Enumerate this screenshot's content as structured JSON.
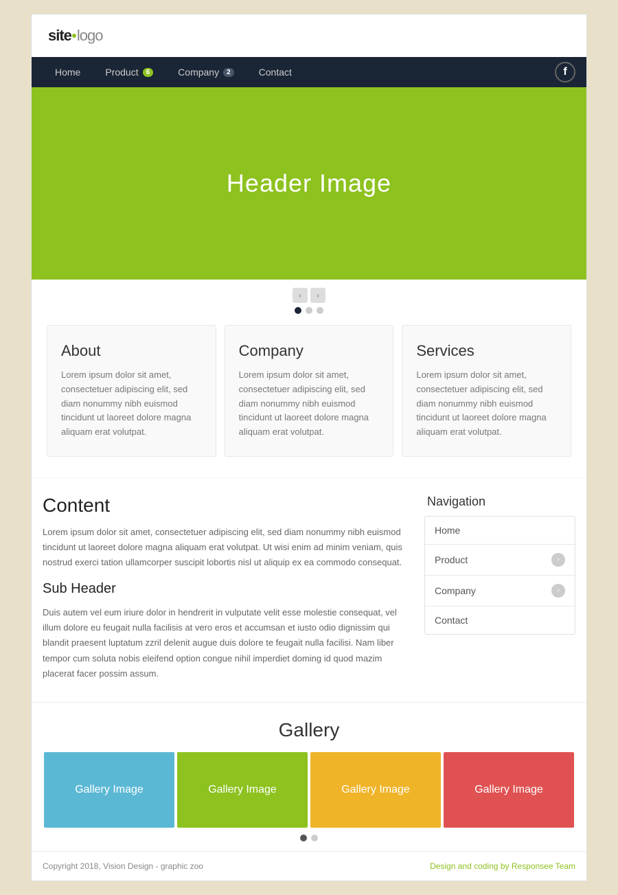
{
  "header": {
    "logo_site": "site",
    "logo_rest": "logo"
  },
  "nav": {
    "items": [
      {
        "label": "Home",
        "badge": null
      },
      {
        "label": "Product",
        "badge": "6",
        "badge_type": "green"
      },
      {
        "label": "Company",
        "badge": "2",
        "badge_type": "dark"
      },
      {
        "label": "Contact",
        "badge": null
      }
    ],
    "facebook_label": "f"
  },
  "hero": {
    "text": "Header Image"
  },
  "slider": {
    "prev_arrow": "‹",
    "next_arrow": "›",
    "dots": [
      true,
      false,
      false
    ]
  },
  "cards": [
    {
      "title": "About",
      "text": "Lorem ipsum dolor sit amet, consectetuer adipiscing elit, sed diam nonummy nibh euismod tincidunt ut laoreet dolore magna aliquam erat volutpat."
    },
    {
      "title": "Company",
      "text": "Lorem ipsum dolor sit amet, consectetuer adipiscing elit, sed diam nonummy nibh euismod tincidunt ut laoreet dolore magna aliquam erat volutpat."
    },
    {
      "title": "Services",
      "text": "Lorem ipsum dolor sit amet, consectetuer adipiscing elit, sed diam nonummy nibh euismod tincidunt ut laoreet dolore magna aliquam erat volutpat."
    }
  ],
  "content": {
    "title": "Content",
    "main_text": "Lorem ipsum dolor sit amet, consectetuer adipiscing elit, sed diam nonummy nibh euismod tincidunt ut laoreet dolore magna aliquam erat volutpat. Ut wisi enim ad minim veniam, quis nostrud exerci tation ullamcorper suscipit lobortis nisl ut aliquip ex ea commodo consequat.",
    "sub_header": "Sub Header",
    "sub_text": "Duis autem vel eum iriure dolor in hendrerit in vulputate velit esse molestie consequat, vel illum dolore eu feugait nulla facilisis at vero eros et accumsan et iusto odio dignissim qui blandit praesent luptatum zzril delenit augue duis dolore te feugait nulla facilisi. Nam liber tempor cum soluta nobis eleifend option congue nihil imperdiet doming id quod mazim placerat facer possim assum."
  },
  "sidebar_nav": {
    "title": "Navigation",
    "items": [
      {
        "label": "Home",
        "has_arrow": false
      },
      {
        "label": "Product",
        "has_arrow": true
      },
      {
        "label": "Company",
        "has_arrow": true
      },
      {
        "label": "Contact",
        "has_arrow": false
      }
    ]
  },
  "gallery": {
    "title": "Gallery",
    "items": [
      {
        "label": "Gallery Image",
        "color": "#5bb8d4"
      },
      {
        "label": "Gallery Image",
        "color": "#8dc21f"
      },
      {
        "label": "Gallery Image",
        "color": "#f0b429"
      },
      {
        "label": "Gallery Image",
        "color": "#e05252"
      }
    ],
    "dots": [
      true,
      false
    ]
  },
  "footer": {
    "left": "Copyright 2018, Vision Design - graphic zoo",
    "right": "Design and coding by Responsee Team"
  }
}
